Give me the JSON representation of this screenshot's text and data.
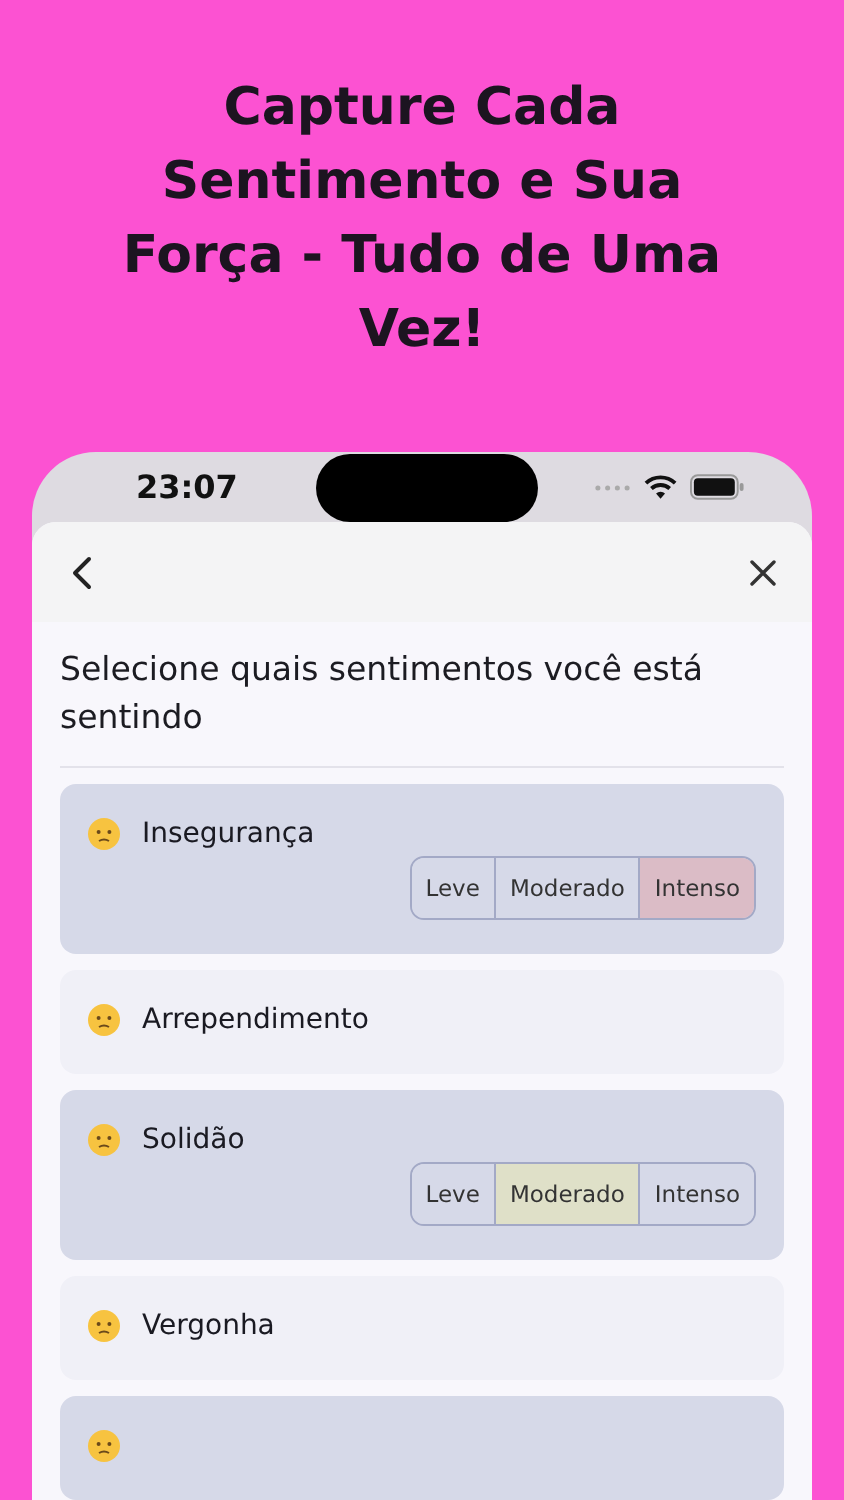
{
  "headline": "Capture Cada Sentimento e Sua Força - Tudo de Uma Vez!",
  "status_bar": {
    "time": "23:07"
  },
  "prompt": "Selecione quais sentimentos você está sentindo",
  "feelings": [
    {
      "label": "Insegurança",
      "selected": true,
      "intensity": [
        {
          "label": "Leve",
          "selected": false
        },
        {
          "label": "Moderado",
          "selected": false
        },
        {
          "label": "Intenso",
          "selected": true
        }
      ]
    },
    {
      "label": "Arrependimento",
      "selected": false
    },
    {
      "label": "Solidão",
      "selected": true,
      "intensity": [
        {
          "label": "Leve",
          "selected": false
        },
        {
          "label": "Moderado",
          "selected": true
        },
        {
          "label": "Intenso",
          "selected": false
        }
      ]
    },
    {
      "label": "Vergonha",
      "selected": false
    },
    {
      "selected": true
    }
  ]
}
